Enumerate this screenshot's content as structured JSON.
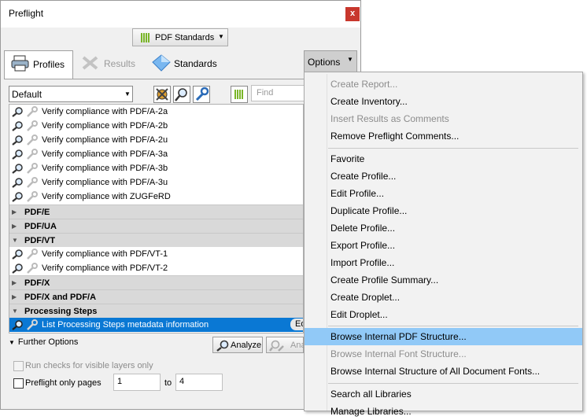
{
  "window": {
    "title": "Preflight",
    "close_label": "x"
  },
  "standards_button": {
    "label": "PDF Standards"
  },
  "tabs": [
    {
      "label": "Profiles"
    },
    {
      "label": "Results"
    },
    {
      "label": "Standards"
    }
  ],
  "options_button": {
    "label": "Options"
  },
  "profile_select": {
    "value": "Default"
  },
  "find": {
    "placeholder": "Find"
  },
  "list": {
    "pdfa_items": [
      "Verify compliance with PDF/A-2a",
      "Verify compliance with PDF/A-2b",
      "Verify compliance with PDF/A-2u",
      "Verify compliance with PDF/A-3a",
      "Verify compliance with PDF/A-3b",
      "Verify compliance with PDF/A-3u",
      "Verify compliance with ZUGFeRD"
    ],
    "group_pdfe": "PDF/E",
    "group_pdfua": "PDF/UA",
    "group_pdfvt": "PDF/VT",
    "pdfvt_items": [
      "Verify compliance with PDF/VT-1",
      "Verify compliance with PDF/VT-2"
    ],
    "group_pdfx": "PDF/X",
    "group_pdfx_pdfa": "PDF/X and PDF/A",
    "group_processing": "Processing Steps",
    "selected_item": "List Processing Steps metadata information",
    "edit_label": "Edi"
  },
  "further_options": "Further Options",
  "analyze_button": "Analyze",
  "analyze_fix_button": "Ana",
  "run_checks_label": "Run checks for visible layers only",
  "preflight_pages_label": "Preflight only pages",
  "page_from": "1",
  "page_to_label": "to",
  "page_to": "4",
  "menu": {
    "create_report": "Create Report...",
    "create_inventory": "Create Inventory...",
    "insert_results": "Insert Results as Comments",
    "remove_comments": "Remove Preflight Comments...",
    "favorite": "Favorite",
    "create_profile": "Create Profile...",
    "edit_profile": "Edit Profile...",
    "duplicate_profile": "Duplicate Profile...",
    "delete_profile": "Delete Profile...",
    "export_profile": "Export Profile...",
    "import_profile": "Import Profile...",
    "create_summary": "Create Profile Summary...",
    "create_droplet": "Create Droplet...",
    "edit_droplet": "Edit Droplet...",
    "browse_structure": "Browse Internal PDF Structure...",
    "browse_font": "Browse Internal Font Structure...",
    "browse_all_fonts": "Browse Internal Structure of All Document Fonts...",
    "search_libraries": "Search all Libraries",
    "manage_libraries": "Manage Libraries..."
  },
  "colors": {
    "selection": "#0a78d4",
    "menu_highlight": "#91c9f7",
    "close": "#c8372d"
  }
}
